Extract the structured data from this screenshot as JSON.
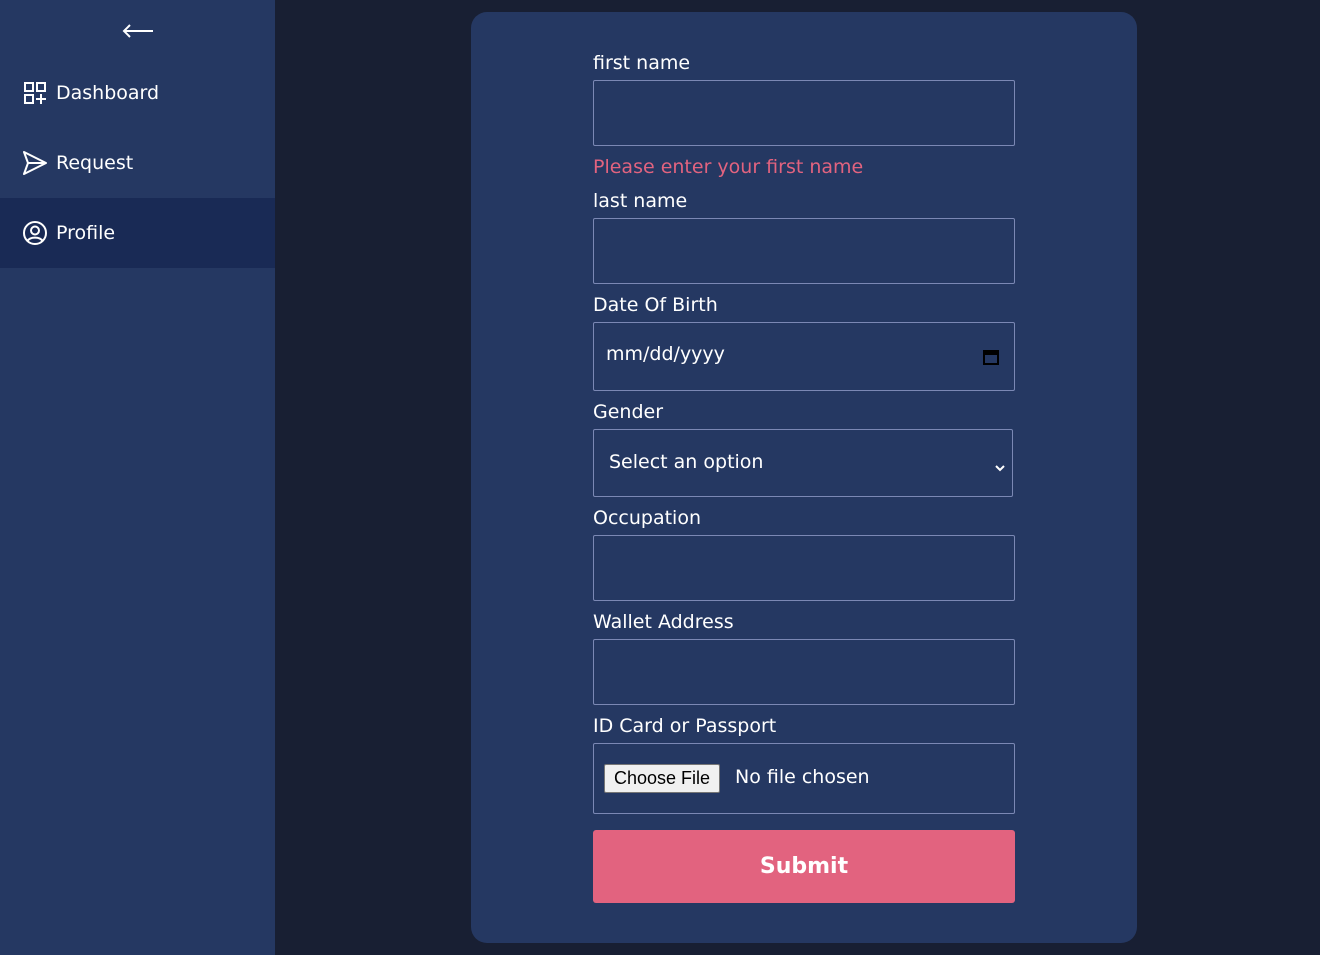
{
  "sidebar": {
    "back_icon": "arrow-left-icon",
    "items": [
      {
        "label": "Dashboard",
        "icon": "dashboard-grid-icon"
      },
      {
        "label": "Request",
        "icon": "send-icon"
      },
      {
        "label": "Profile",
        "icon": "user-circle-icon",
        "active": true
      }
    ]
  },
  "form": {
    "first_name": {
      "label": "first name",
      "value": "",
      "error": "Please enter your first name"
    },
    "last_name": {
      "label": "last name",
      "value": ""
    },
    "dob": {
      "label": "Date Of Birth",
      "placeholder": "mm/dd/yyyy",
      "icon": "calendar-icon"
    },
    "gender": {
      "label": "Gender",
      "selected": "Select an option",
      "icon": "chevron-down-icon"
    },
    "occupation": {
      "label": "Occupation",
      "value": ""
    },
    "wallet": {
      "label": "Wallet Address",
      "value": ""
    },
    "id_doc": {
      "label": "ID Card or Passport",
      "button": "Choose File",
      "status": "No file chosen"
    },
    "submit_label": "Submit"
  },
  "colors": {
    "background": "#181f33",
    "panel": "#253862",
    "active_nav": "#192a55",
    "accent": "#e2637f",
    "field_border": "#7b88b4"
  }
}
